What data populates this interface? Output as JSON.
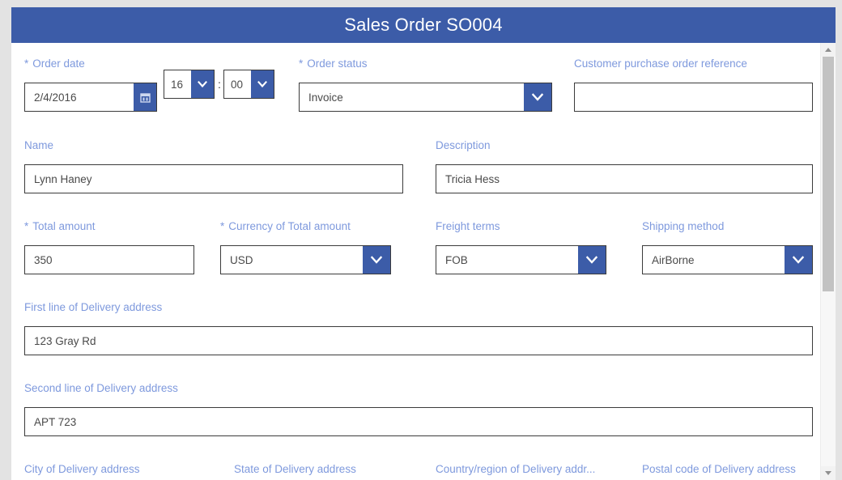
{
  "header": {
    "title": "Sales Order SO004"
  },
  "fields": {
    "order_date": {
      "label": "Order date",
      "required": true,
      "value": "2/4/2016",
      "icon": "calendar-icon"
    },
    "order_hour": {
      "value": "16"
    },
    "time_separator": ":",
    "order_minute": {
      "value": "00"
    },
    "order_status": {
      "label": "Order status",
      "required": true,
      "value": "Invoice"
    },
    "customer_po_reference": {
      "label": "Customer purchase order reference",
      "required": false,
      "value": "",
      "placeholder": ""
    },
    "name": {
      "label": "Name",
      "required": false,
      "value": "Lynn Haney"
    },
    "description": {
      "label": "Description",
      "required": false,
      "value": "Tricia Hess"
    },
    "total_amount": {
      "label": "Total amount",
      "required": true,
      "value": "350"
    },
    "currency": {
      "label": "Currency of Total amount",
      "required": true,
      "value": "USD"
    },
    "freight_terms": {
      "label": "Freight terms",
      "required": false,
      "value": "FOB"
    },
    "shipping_method": {
      "label": "Shipping method",
      "required": false,
      "value": "AirBorne"
    },
    "delivery_address_1": {
      "label": "First line of Delivery address",
      "required": false,
      "value": "123 Gray Rd"
    },
    "delivery_address_2": {
      "label": "Second line of Delivery address",
      "required": false,
      "value": "APT 723"
    },
    "delivery_city": {
      "label": "City of Delivery address"
    },
    "delivery_state": {
      "label": "State of Delivery address"
    },
    "delivery_country": {
      "label": "Country/region of Delivery addr..."
    },
    "delivery_postal_code": {
      "label": "Postal code of Delivery address"
    }
  },
  "required_marker": "*",
  "colors": {
    "header_blue": "#3c5ca8",
    "label_blue": "#7e99dd",
    "input_border": "#3b3b3b",
    "page_background": "#e3e3e3",
    "card_background": "#ffffff",
    "scrollbar_thumb": "#c2c2c2"
  }
}
